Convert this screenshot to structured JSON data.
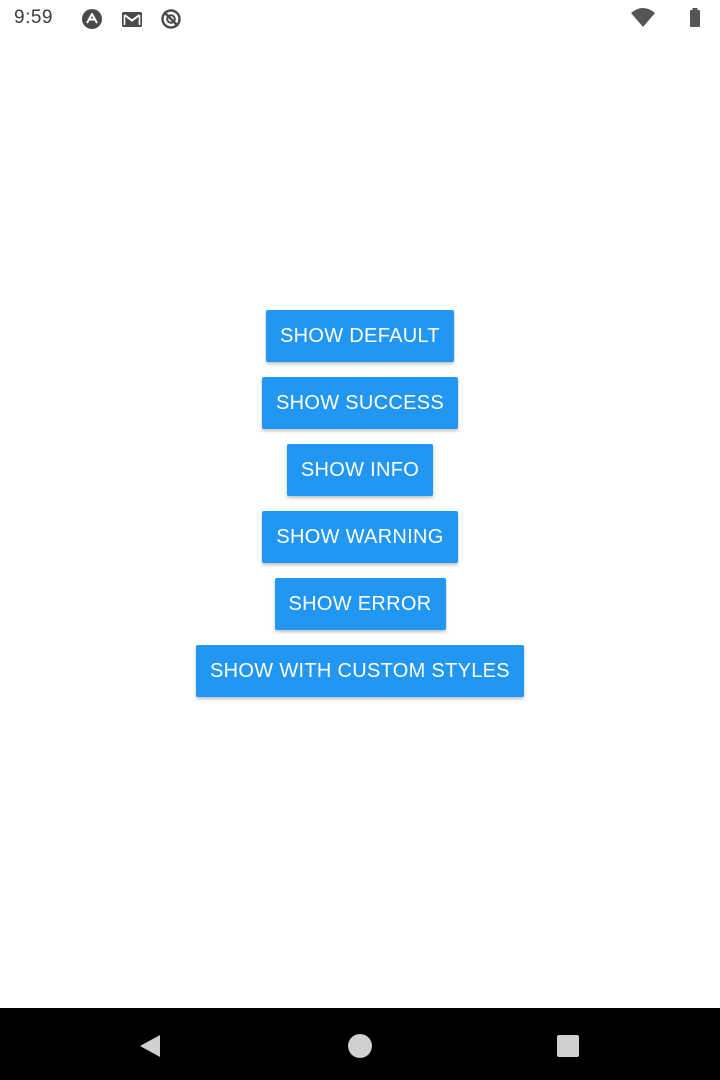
{
  "status_bar": {
    "time": "9:59",
    "notification_icons": [
      "android-logo-icon",
      "gmail-icon",
      "sync-off-icon"
    ],
    "system_icons": [
      "wifi-icon",
      "battery-icon"
    ]
  },
  "buttons": [
    {
      "name": "show-default-button",
      "label": "SHOW DEFAULT"
    },
    {
      "name": "show-success-button",
      "label": "SHOW SUCCESS"
    },
    {
      "name": "show-info-button",
      "label": "SHOW INFO"
    },
    {
      "name": "show-warning-button",
      "label": "SHOW WARNING"
    },
    {
      "name": "show-error-button",
      "label": "SHOW ERROR"
    },
    {
      "name": "show-with-custom-styles-button",
      "label": "SHOW WITH CUSTOM STYLES"
    }
  ],
  "colors": {
    "button_background": "#2196f3",
    "button_text": "#ffffff",
    "nav_bar": "#000000",
    "background": "#ffffff"
  },
  "nav_bar": {
    "icons": [
      "back-icon",
      "home-icon",
      "recents-icon"
    ]
  }
}
